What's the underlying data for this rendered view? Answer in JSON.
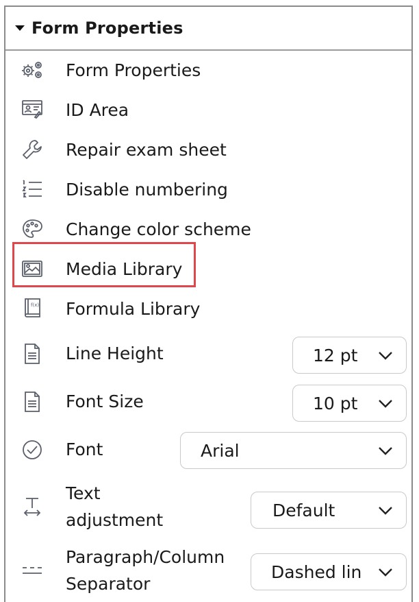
{
  "panel": {
    "header_title": "Form Properties",
    "menu_items": [
      {
        "label": "Form Properties",
        "icon": "gears-icon"
      },
      {
        "label": "ID Area",
        "icon": "id-card-icon"
      },
      {
        "label": "Repair exam sheet",
        "icon": "wrench-icon"
      },
      {
        "label": "Disable numbering",
        "icon": "numbered-list-icon"
      },
      {
        "label": "Change color scheme",
        "icon": "palette-icon"
      },
      {
        "label": "Media Library",
        "icon": "image-icon",
        "highlighted": true
      },
      {
        "label": "Formula Library",
        "icon": "formula-book-icon"
      }
    ],
    "properties": [
      {
        "label": "Line Height",
        "value": "12 pt",
        "icon": "document-icon"
      },
      {
        "label": "Font Size",
        "value": "10 pt",
        "icon": "document-icon"
      },
      {
        "label": "Font",
        "value": "Arial",
        "icon": "check-circle-icon"
      },
      {
        "label_line1": "Text",
        "label_line2": "adjustment",
        "value": "Default",
        "icon": "text-adjust-icon"
      },
      {
        "label_line1": "Paragraph/Column",
        "label_line2": "Separator",
        "value": "Dashed lin",
        "icon": "dashed-line-icon"
      }
    ]
  },
  "colors": {
    "highlight": "#e0474c",
    "icon": "#5a5f6b",
    "border": "#8a8a8a"
  }
}
